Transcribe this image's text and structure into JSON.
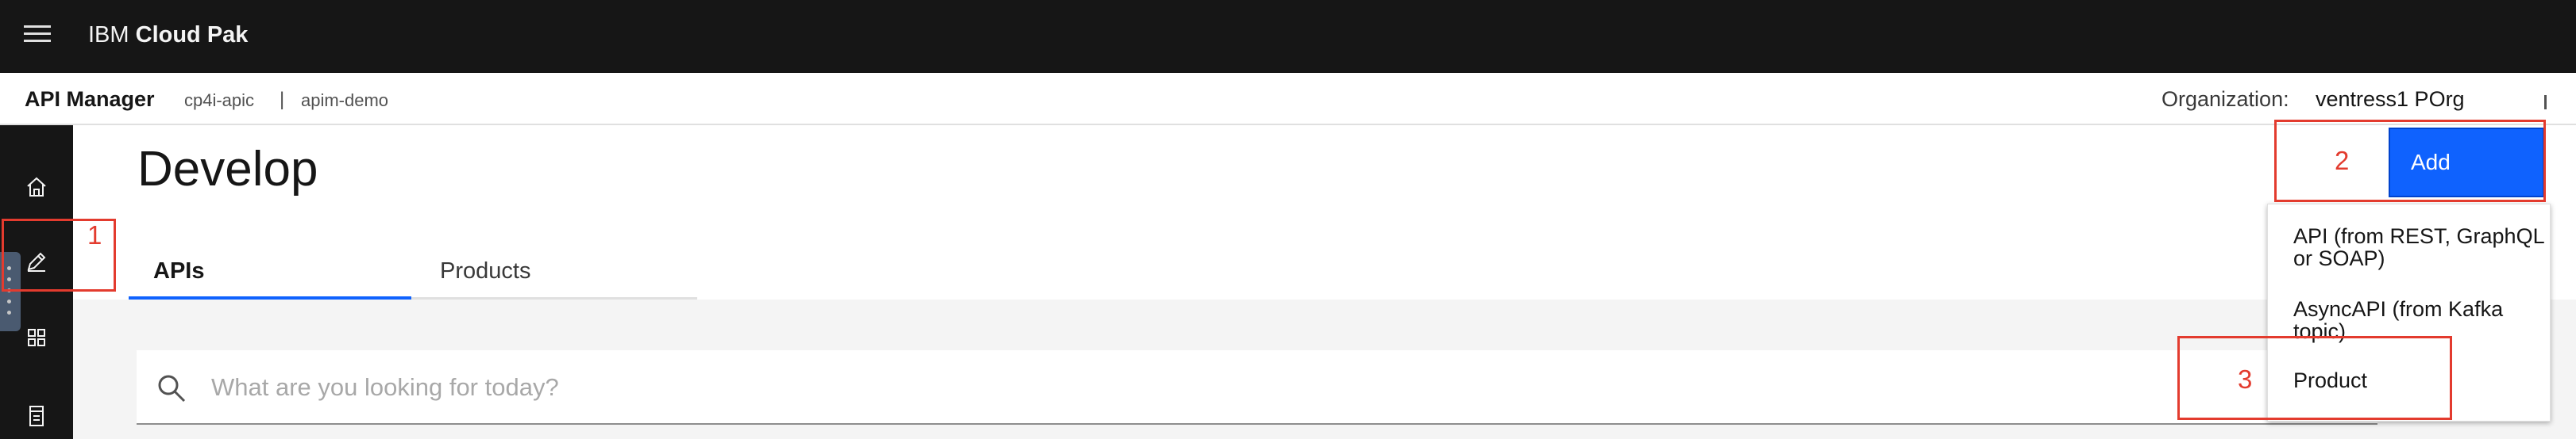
{
  "header": {
    "brand_prefix": "IBM",
    "brand_name": "Cloud Pak"
  },
  "subheader": {
    "product": "API Manager",
    "namespace": "cp4i-apic",
    "separator": "|",
    "instance": "apim-demo",
    "org_label": "Organization:",
    "org_value": "ventress1 POrg"
  },
  "left_nav": {
    "items": [
      "home-icon",
      "edit-icon",
      "apps-grid-icon",
      "catalog-icon"
    ]
  },
  "main": {
    "title": "Develop",
    "tabs": [
      {
        "label": "APIs",
        "selected": true
      },
      {
        "label": "Products",
        "selected": false
      }
    ],
    "search": {
      "placeholder": "What are you looking for today?"
    }
  },
  "add_button": {
    "label": "Add",
    "menu": [
      {
        "label": "API (from REST, GraphQL or SOAP)"
      },
      {
        "label": "AsyncAPI (from Kafka topic)"
      },
      {
        "label": "Product"
      }
    ]
  },
  "annotations": [
    {
      "number": "1"
    },
    {
      "number": "2"
    },
    {
      "number": "3"
    }
  ],
  "colors": {
    "header_bg": "#161616",
    "accent": "#0f62fe",
    "annotation": "#e33b2e"
  }
}
